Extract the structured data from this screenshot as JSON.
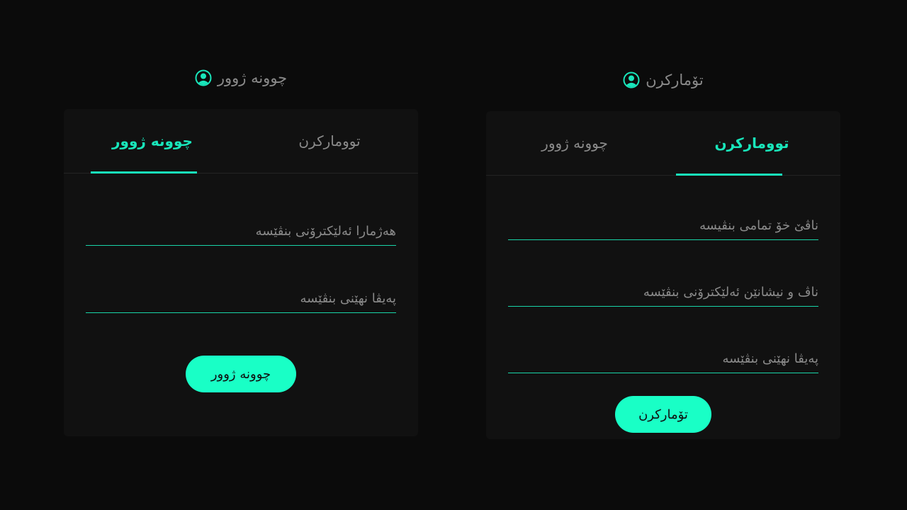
{
  "login": {
    "heading": "چوونە ژوور",
    "heading_icon": "user-circle-icon",
    "tabs": [
      {
        "label": "چوونە ژوور",
        "active": true
      },
      {
        "label": "تووماركرن",
        "active": false
      }
    ],
    "fields": {
      "email_placeholder": "هەژمارا ئەلێکترۆنی بنڤێسە",
      "password_placeholder": "پەیڤا نهێنی بنڤێسە"
    },
    "submit_label": "چوونە ژوور"
  },
  "register": {
    "heading": "تۆمارکرن",
    "heading_icon": "user-circle-icon",
    "tabs": [
      {
        "label": "چوونە ژوور",
        "active": false
      },
      {
        "label": "تووماركرن",
        "active": true
      }
    ],
    "fields": {
      "fullname_placeholder": "ناڤێ خۆ تمامی بنڤیسە",
      "email_placeholder": "ناڤ و نیشانێن ئەلێکترۆنی بنڤێسە",
      "password_placeholder": "پەیڤا نهێنی بنڤێسە"
    },
    "submit_label": "تۆمارکرن"
  },
  "colors": {
    "accent": "#19e6bb",
    "button": "#19ffc6",
    "background": "#0b0b0b",
    "card": "#111111"
  }
}
